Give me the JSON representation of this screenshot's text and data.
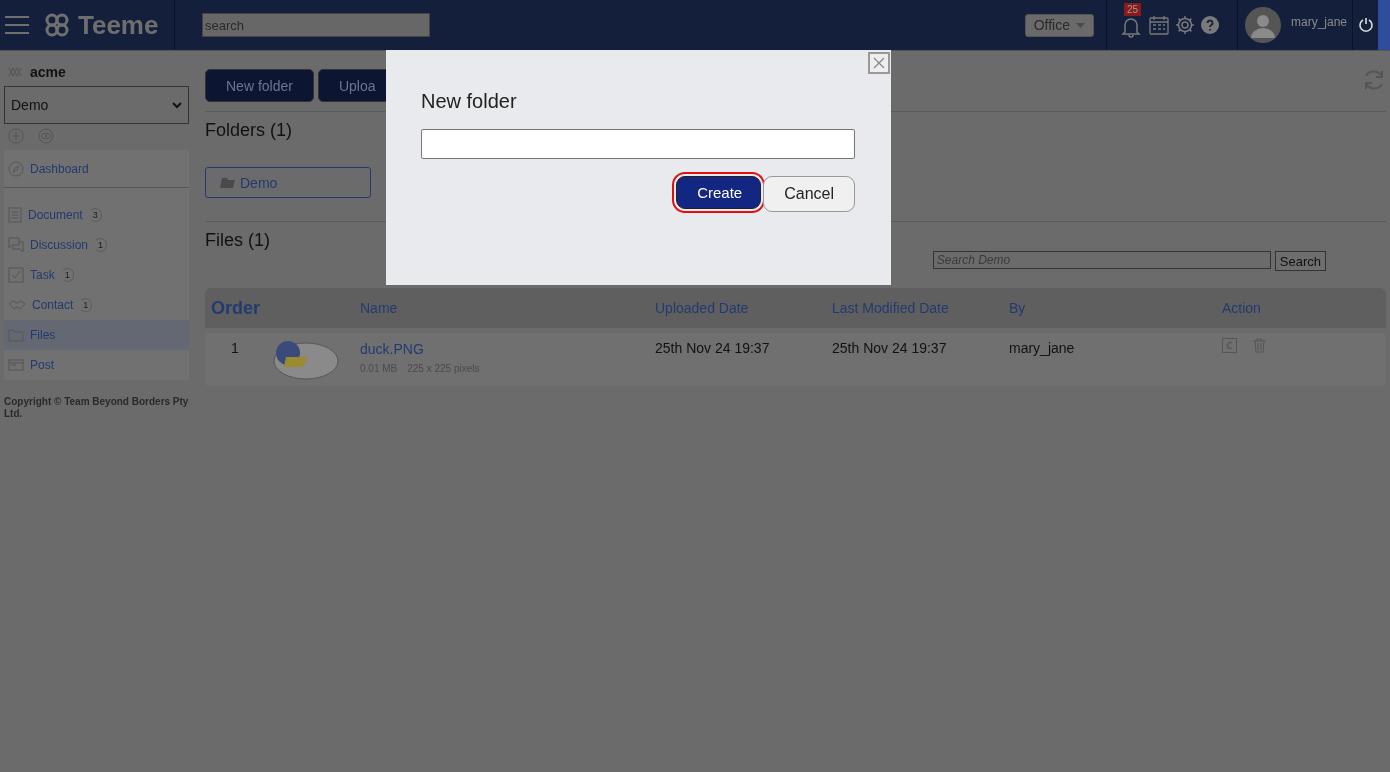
{
  "header": {
    "logo": "Teeme",
    "search": {
      "placeholder": "search"
    },
    "office": "Office",
    "notifications": "25",
    "user": "mary_jane"
  },
  "sidebar": {
    "workspace": "acme",
    "space_select": "Demo",
    "sections": [
      {
        "items": [
          {
            "label": "Dashboard",
            "kind": "dashboard",
            "selected": false
          }
        ]
      },
      {
        "items": [
          {
            "label": "Document",
            "kind": "document",
            "count": "3",
            "selected": false
          },
          {
            "label": "Discussion",
            "kind": "discussion",
            "count": "1",
            "selected": false
          },
          {
            "label": "Task",
            "kind": "task",
            "count": "1",
            "selected": false
          },
          {
            "label": "Contact",
            "kind": "contact",
            "count": "1",
            "selected": false
          },
          {
            "label": "Files",
            "kind": "files",
            "selected": true
          },
          {
            "label": "Post",
            "kind": "post",
            "selected": false
          }
        ]
      }
    ],
    "copyright": "Copyright © Team Beyond Borders Pty Ltd."
  },
  "toolbar": {
    "buttons": [
      "New folder",
      "Uploa"
    ]
  },
  "folders": {
    "heading": "Folders (1)",
    "items": [
      "Demo"
    ]
  },
  "files": {
    "heading": "Files (1)",
    "search": {
      "placeholder": "Search Demo",
      "button": "Search"
    },
    "columns": [
      "Order",
      "Name",
      "Uploaded Date",
      "Last Modified Date",
      "By",
      "Action"
    ],
    "rows": [
      {
        "order": "1",
        "name": "duck.PNG",
        "size": "0.01 MB",
        "dimensions": "225 x 225 pixels",
        "uploaded": "25th Nov 24 19:37",
        "modified": "25th Nov 24 19:37",
        "by": "mary_jane"
      }
    ]
  },
  "dialog": {
    "title": "New folder",
    "buttons": [
      {
        "label": "Create",
        "kind": "primary",
        "highlighted": true
      },
      {
        "label": "Cancel",
        "kind": "secondary",
        "highlighted": false
      }
    ]
  }
}
